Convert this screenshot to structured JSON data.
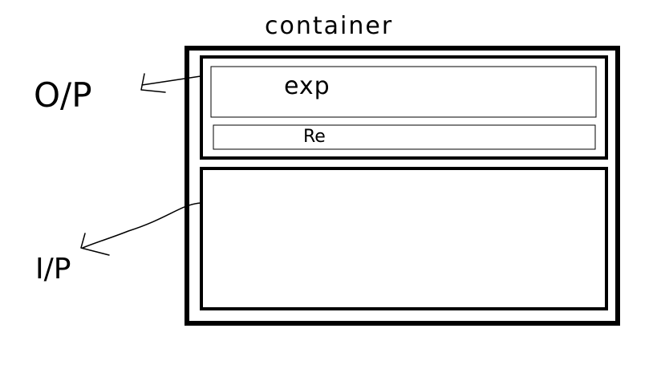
{
  "title": "container",
  "left_labels": {
    "output": "O/P",
    "input": "I/P"
  },
  "output_panel": {
    "expression_text": "exp",
    "result_text": "Re"
  },
  "colors": {
    "ink": "#000000",
    "background": "#ffffff"
  }
}
